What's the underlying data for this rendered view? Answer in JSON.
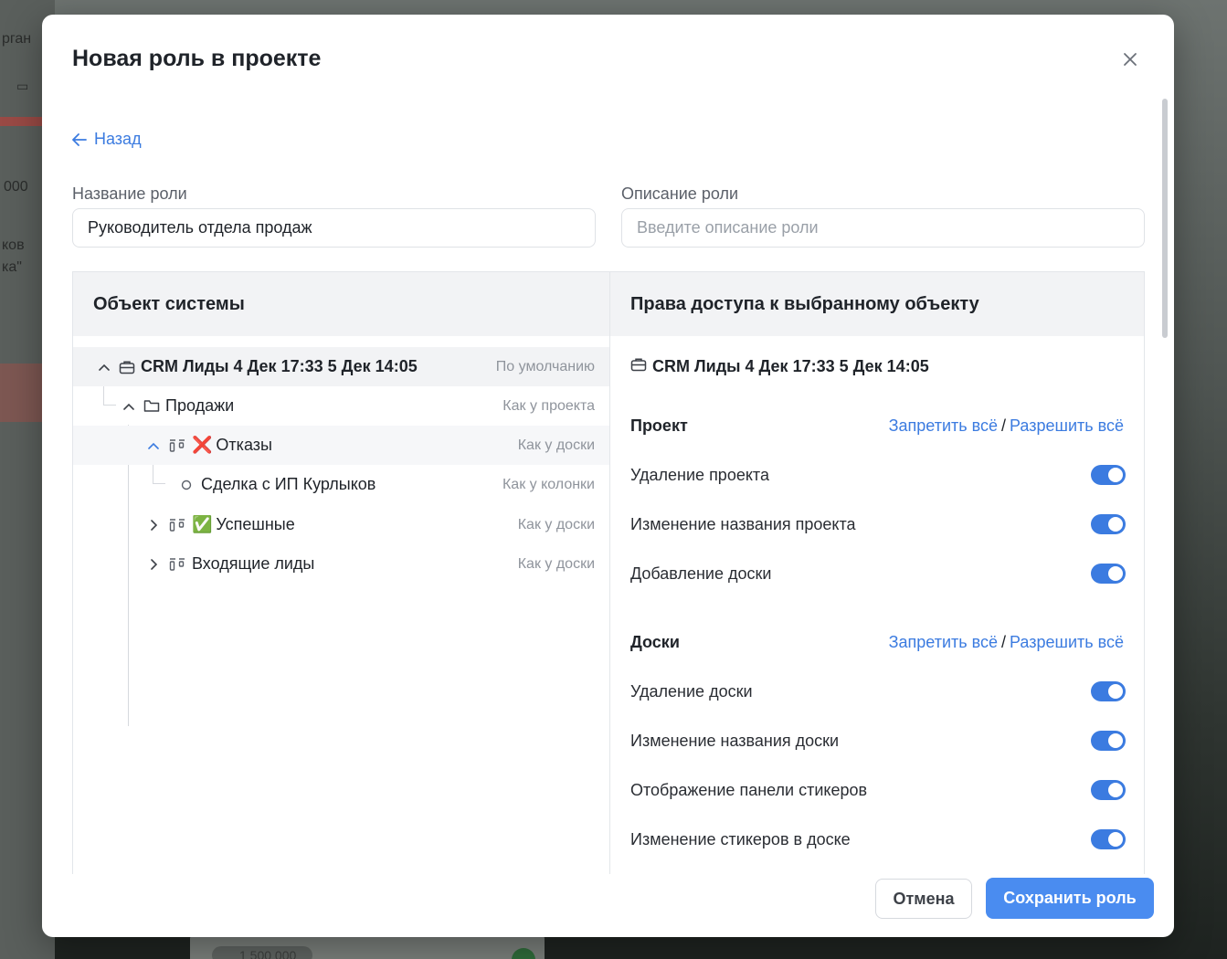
{
  "background": {
    "fragments": [
      "рган",
      "000",
      "ков",
      "ка\""
    ],
    "card_value": "1 500 000"
  },
  "modal": {
    "title": "Новая роль в проекте",
    "back_label": "Назад",
    "role_name": {
      "label": "Название роли",
      "value": "Руководитель отдела продаж"
    },
    "role_description": {
      "label": "Описание роли",
      "placeholder": "Введите описание роли"
    }
  },
  "tree": {
    "header": "Объект системы",
    "rows": [
      {
        "label": "CRM Лиды 4 Дек 17:33 5 Дек 14:05",
        "tag": "По умолчанию",
        "icon": "briefcase-icon"
      },
      {
        "label": "Продажи",
        "tag": "Как у проекта",
        "icon": "folder-icon"
      },
      {
        "emoji": "❌",
        "label": "Отказы",
        "tag": "Как у доски",
        "icon": "board-icon"
      },
      {
        "label": "Сделка с ИП Курлыков",
        "tag": "Как у колонки",
        "icon": "circle-icon"
      },
      {
        "emoji": "✅",
        "label": "Успешные",
        "tag": "Как у доски",
        "icon": "board-icon"
      },
      {
        "label": "Входящие лиды",
        "tag": "Как у доски",
        "icon": "board-icon"
      }
    ]
  },
  "permissions": {
    "header": "Права доступа к выбранному объекту",
    "object_title": "CRM Лиды 4 Дек 17:33 5 Дек 14:05",
    "deny_all": "Запретить всё",
    "separator": "/",
    "allow_all": "Разрешить всё",
    "sections": [
      {
        "title": "Проект",
        "items": [
          {
            "label": "Удаление проекта",
            "enabled": true
          },
          {
            "label": "Изменение названия проекта",
            "enabled": true
          },
          {
            "label": "Добавление доски",
            "enabled": true
          }
        ]
      },
      {
        "title": "Доски",
        "items": [
          {
            "label": "Удаление доски",
            "enabled": true
          },
          {
            "label": "Изменение названия доски",
            "enabled": true
          },
          {
            "label": "Отображение панели стикеров",
            "enabled": true
          },
          {
            "label": "Изменение стикеров в доске",
            "enabled": true
          }
        ]
      }
    ]
  },
  "footer": {
    "cancel_label": "Отмена",
    "save_label": "Сохранить роль"
  },
  "colors": {
    "accent": "#3b7be0",
    "primary_button": "#4a8cf0",
    "selected_row": "#f2f3f5"
  }
}
